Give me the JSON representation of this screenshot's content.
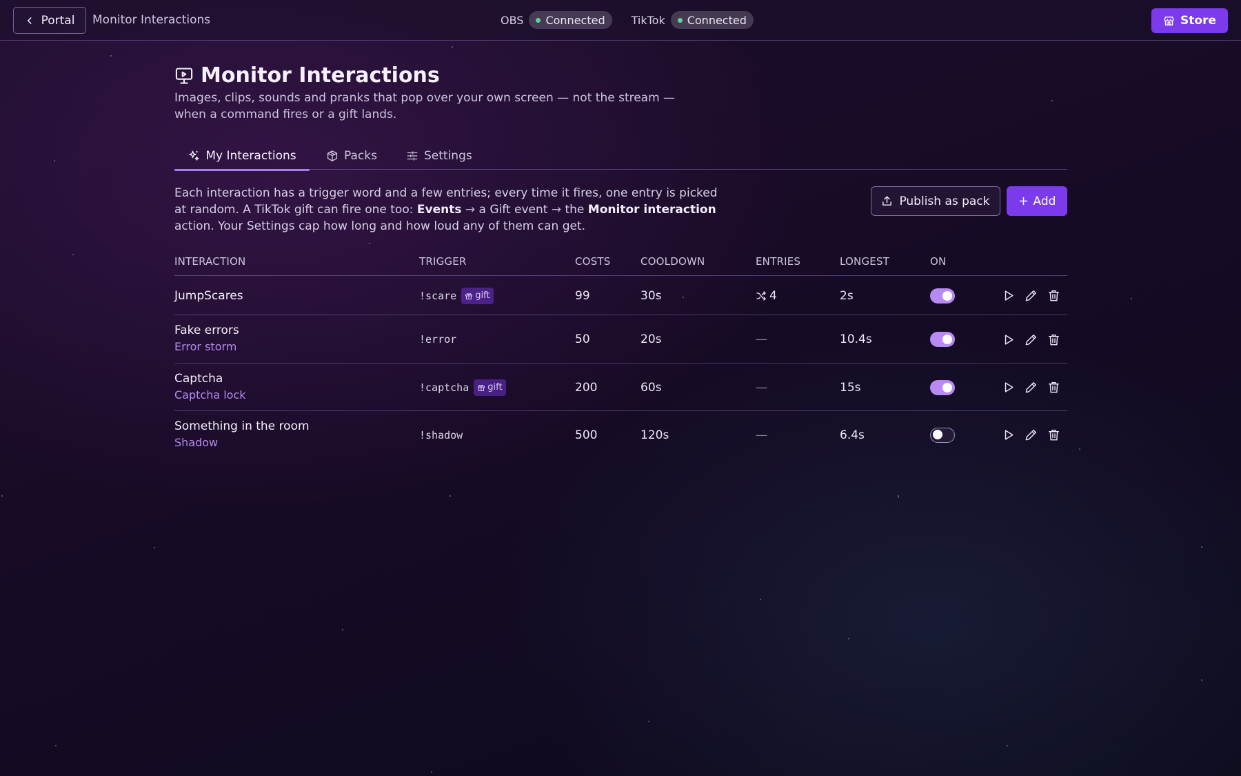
{
  "topbar": {
    "back_label": "Portal",
    "crumb": "Monitor Interactions",
    "obs_label": "OBS",
    "obs_status": "Connected",
    "tiktok_label": "TikTok",
    "tiktok_status": "Connected",
    "store_label": "Store"
  },
  "header": {
    "title": "Monitor Interactions",
    "subtitle": "Images, clips, sounds and pranks that pop over your own screen — not the stream — when a command fires or a gift lands."
  },
  "tabs": [
    {
      "label": "My Interactions",
      "icon": "sparkles-icon",
      "active": true
    },
    {
      "label": "Packs",
      "icon": "package-icon",
      "active": false
    },
    {
      "label": "Settings",
      "icon": "sliders-icon",
      "active": false
    }
  ],
  "intro": {
    "p1": "Each interaction has a trigger word and a few entries; every time it fires, one entry is picked at random. A TikTok gift can fire one too: ",
    "b1": "Events",
    "a1": " → ",
    "p2": "a Gift event",
    "a2": " → ",
    "p3": "the ",
    "b2": "Monitor interaction",
    "p4": " action. Your Settings cap how long and how loud any of them can get."
  },
  "actions": {
    "publish_label": "Publish as pack",
    "add_label": "Add"
  },
  "table": {
    "headers": {
      "interaction": "INTERACTION",
      "trigger": "TRIGGER",
      "costs": "COSTS",
      "cooldown": "COOLDOWN",
      "entries": "ENTRIES",
      "longest": "LONGEST",
      "on": "ON"
    },
    "rows": [
      {
        "name": "JumpScares",
        "sub": "",
        "trigger": "!scare",
        "gift": "gift",
        "costs": "99",
        "cooldown": "30s",
        "entries": "4",
        "longest": "2s",
        "on": true
      },
      {
        "name": "Fake errors",
        "sub": "Error storm",
        "trigger": "!error",
        "gift": "",
        "costs": "50",
        "cooldown": "20s",
        "entries": "—",
        "longest": "10.4s",
        "on": true
      },
      {
        "name": "Captcha",
        "sub": "Captcha lock",
        "trigger": "!captcha",
        "gift": "gift",
        "costs": "200",
        "cooldown": "60s",
        "entries": "—",
        "longest": "15s",
        "on": true
      },
      {
        "name": "Something in the room",
        "sub": "Shadow",
        "trigger": "!shadow",
        "gift": "",
        "costs": "500",
        "cooldown": "120s",
        "entries": "—",
        "longest": "6.4s",
        "on": false
      }
    ]
  },
  "colors": {
    "accent": "#7c3aed",
    "toggle_on": "#b98af3",
    "status_dot": "#5fd39a",
    "sub_label": "#b68bf0"
  }
}
